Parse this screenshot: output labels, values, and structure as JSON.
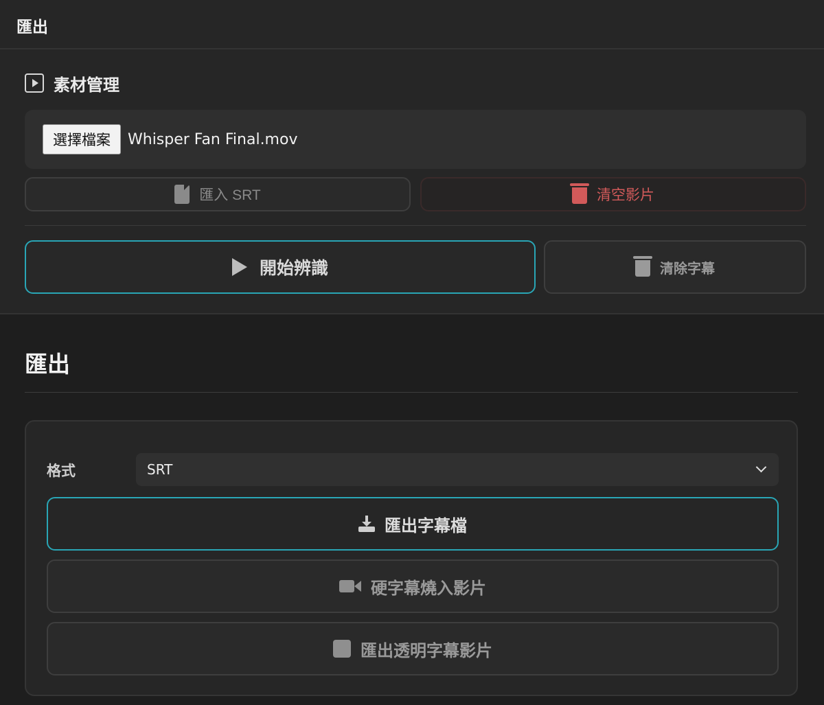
{
  "topbar": {
    "title": "匯出"
  },
  "assets": {
    "heading": "素材管理",
    "choose_file_label": "選擇檔案",
    "file_name": "Whisper Fan Final.mov",
    "import_srt_label": "匯入 SRT",
    "clear_video_label": "清空影片",
    "start_label": "開始辨識",
    "clear_subtitles_label": "清除字幕"
  },
  "export": {
    "title": "匯出",
    "format_label": "格式",
    "format_value": "SRT",
    "export_subtitle_label": "匯出字幕檔",
    "burn_in_label": "硬字幕燒入影片",
    "export_transparent_label": "匯出透明字幕影片"
  },
  "colors": {
    "accent": "#29a6b6",
    "danger": "#d25a5a",
    "background": "#1e1e1e",
    "panel": "#262626"
  },
  "icons": {
    "section": "play-square-icon",
    "import": "document-icon",
    "clear_video": "trash-icon",
    "start": "play-icon",
    "clear_subtitles": "trash-icon",
    "export_subtitle": "download-icon",
    "burn_in": "video-camera-icon",
    "export_transparent": "square-icon"
  }
}
